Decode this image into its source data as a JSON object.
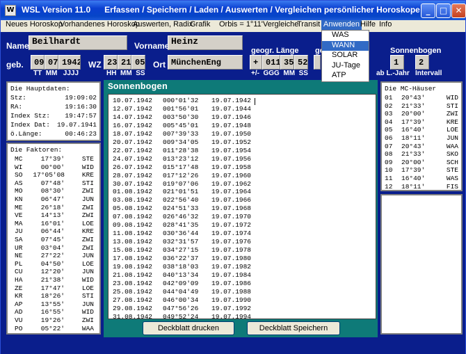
{
  "window": {
    "title": "WSL Version 11.0      Erfassen / Speichern / Laden / Auswerten / Vergleichen persönlicher Horoskope",
    "icon_label": "W"
  },
  "menu": [
    {
      "label": "Neues Horoskop"
    },
    {
      "label": "Vorhandenes Horoskop"
    },
    {
      "label": "Auswerten, Radix"
    },
    {
      "label": "Grafik"
    },
    {
      "label": "Orbis = 1°11'"
    },
    {
      "label": "Vergleiche"
    },
    {
      "label": "Transit"
    },
    {
      "label": "Anwenden"
    },
    {
      "label": "Hilfe"
    },
    {
      "label": "Info"
    }
  ],
  "dropdown": {
    "items": [
      "WAS",
      "WANN",
      "SOLAR",
      "JU-Tage",
      "ATP"
    ],
    "selected": "WANN"
  },
  "form": {
    "name_label": "Name",
    "name_value": "Beilhardt",
    "vorname_label": "Vorname",
    "vorname_value": "Heinz",
    "geb_label": "geb.",
    "tt": "09",
    "mm": "07",
    "jjjj": "1942",
    "date_sub": "TT  MM   JJJJ",
    "wz_label": "WZ",
    "hh": "23",
    "min": "21",
    "ss": "05",
    "time_sub": "HH  MM  SS",
    "ort_label": "Ort",
    "ort_value": "MünchenEng",
    "laenge_label": "geogr. Länge",
    "laenge_sign": "+",
    "laenge_g": "011",
    "laenge_m": "35",
    "laenge_s": "52",
    "laenge_sub": "+/-  GGG  MM  SS",
    "breite_label_partial": "ge",
    "sonnenbogen_label": "Sonnenbogen",
    "sb_value1": "1",
    "sb_value2": "2",
    "sb_sub1": "ab L.-Jahr",
    "sb_sub2": "Intervall"
  },
  "hauptdaten": {
    "title": "Die Hauptdaten:",
    "rows": [
      {
        "k": "Stz:",
        "v": "19:09:02"
      },
      {
        "k": "RA:",
        "v": "19:16:30"
      },
      {
        "k": "Index Stz:",
        "v": "19:47:57"
      },
      {
        "k": "Index Dat:",
        "v": "19.07.1941"
      },
      {
        "k": "ö.Länge:",
        "v": "00:46:23"
      }
    ]
  },
  "faktoren": {
    "title": "Die Faktoren:",
    "rows": [
      [
        "MC",
        "17°39'",
        "STE"
      ],
      [
        "WI",
        "00°00'",
        "WID"
      ],
      [
        "SO",
        "17°05'08",
        "KRE"
      ],
      [
        "AS",
        "07°48'",
        "STI"
      ],
      [
        "MO",
        "08°30'",
        "ZWI"
      ],
      [
        "KN",
        "06°47'",
        "JUN"
      ],
      [
        "ME",
        "26°18'",
        "ZWI"
      ],
      [
        "VE",
        "14°13'",
        "ZWI"
      ],
      [
        "MA",
        "16°01'",
        "LOE"
      ],
      [
        "JU",
        "06°44'",
        "KRE"
      ],
      [
        "SA",
        "07°45'",
        "ZWI"
      ],
      [
        "UR",
        "03°04'",
        "ZWI"
      ],
      [
        "NE",
        "27°22'",
        "JUN"
      ],
      [
        "PL",
        "04°50'",
        "LOE"
      ],
      [
        "CU",
        "12°20'",
        "JUN"
      ],
      [
        "HA",
        "21°38'",
        "WID"
      ],
      [
        "ZE",
        "17°47'",
        "LOE"
      ],
      [
        "KR",
        "18°26'",
        "STI"
      ],
      [
        "AP",
        "13°55'",
        "JUN"
      ],
      [
        "AD",
        "16°55'",
        "WID"
      ],
      [
        "VU",
        "19°26'",
        "ZWI"
      ],
      [
        "PO",
        "05°22'",
        "WAA"
      ]
    ]
  },
  "sonnenbogen": {
    "title": "Sonnenbogen",
    "rows": [
      [
        "10.07.1942",
        "000°01'32",
        "19.07.1942"
      ],
      [
        "12.07.1942",
        "001°56'01",
        "19.07.1944"
      ],
      [
        "14.07.1942",
        "003°50'30",
        "19.07.1946"
      ],
      [
        "16.07.1942",
        "005°45'01",
        "19.07.1948"
      ],
      [
        "18.07.1942",
        "007°39'33",
        "19.07.1950"
      ],
      [
        "20.07.1942",
        "009°34'05",
        "19.07.1952"
      ],
      [
        "22.07.1942",
        "011°28'38",
        "19.07.1954"
      ],
      [
        "24.07.1942",
        "013°23'12",
        "19.07.1956"
      ],
      [
        "26.07.1942",
        "015°17'48",
        "19.07.1958"
      ],
      [
        "28.07.1942",
        "017°12'26",
        "19.07.1960"
      ],
      [
        "30.07.1942",
        "019°07'06",
        "19.07.1962"
      ],
      [
        "01.08.1942",
        "021°01'51",
        "19.07.1964"
      ],
      [
        "03.08.1942",
        "022°56'40",
        "19.07.1966"
      ],
      [
        "05.08.1942",
        "024°51'33",
        "19.07.1968"
      ],
      [
        "07.08.1942",
        "026°46'32",
        "19.07.1970"
      ],
      [
        "09.08.1942",
        "028°41'35",
        "19.07.1972"
      ],
      [
        "11.08.1942",
        "030°36'44",
        "19.07.1974"
      ],
      [
        "13.08.1942",
        "032°31'57",
        "19.07.1976"
      ],
      [
        "15.08.1942",
        "034°27'15",
        "19.07.1978"
      ],
      [
        "17.08.1942",
        "036°22'37",
        "19.07.1980"
      ],
      [
        "19.08.1942",
        "038°18'03",
        "19.07.1982"
      ],
      [
        "21.08.1942",
        "040°13'34",
        "19.07.1984"
      ],
      [
        "23.08.1942",
        "042°09'09",
        "19.07.1986"
      ],
      [
        "25.08.1942",
        "044°04'49",
        "19.07.1988"
      ],
      [
        "27.08.1942",
        "046°00'34",
        "19.07.1990"
      ],
      [
        "29.08.1942",
        "047°56'26",
        "19.07.1992"
      ],
      [
        "31.08.1942",
        "049°52'24",
        "19.07.1994"
      ]
    ],
    "btn_drucken": "Deckblatt drucken",
    "btn_speichern": "Deckblatt Speichern"
  },
  "mc_haeuser": {
    "title": "Die MC-Häuser",
    "rows": [
      [
        "01",
        "20°43'",
        "WID"
      ],
      [
        "02",
        "21°33'",
        "STI"
      ],
      [
        "03",
        "20°00'",
        "ZWI"
      ],
      [
        "04",
        "17°39'",
        "KRE"
      ],
      [
        "05",
        "16°40'",
        "LOE"
      ],
      [
        "06",
        "18°11'",
        "JUN"
      ],
      [
        "07",
        "20°43'",
        "WAA"
      ],
      [
        "08",
        "21°33'",
        "SKO"
      ],
      [
        "09",
        "20°00'",
        "SCH"
      ],
      [
        "10",
        "17°39'",
        "STE"
      ],
      [
        "11",
        "16°40'",
        "WAS"
      ],
      [
        "12",
        "18°11'",
        "FIS"
      ]
    ]
  }
}
